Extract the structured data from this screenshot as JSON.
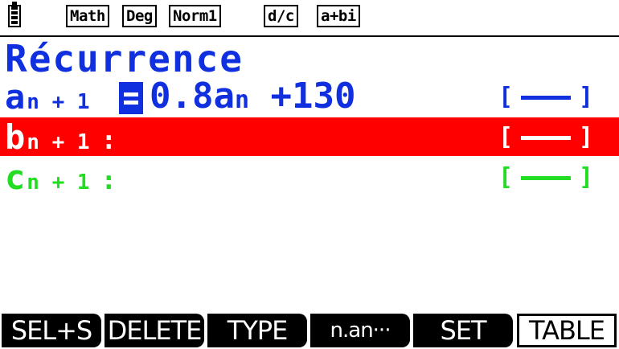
{
  "status": {
    "battery_icon": "battery-full-icon",
    "math_mode": "Math",
    "angle_mode": "Deg",
    "display_mode": "Norm1",
    "fraction_mode": "d/c",
    "complex_mode": "a+bi"
  },
  "title": "Récurrence",
  "colors": {
    "blue": "#1030e0",
    "red": "#ff0000",
    "green": "#22dd22"
  },
  "rows": [
    {
      "var": "a",
      "sub": "n + 1",
      "expr_text": "0.8a",
      "expr_sub": "n",
      "expr_tail": " +130",
      "color": "blue",
      "selected": false
    },
    {
      "var": "b",
      "sub": "n + 1",
      "colon": ":",
      "color": "red",
      "selected": true
    },
    {
      "var": "c",
      "sub": "n + 1",
      "colon": ":",
      "color": "green",
      "selected": false
    }
  ],
  "fkeys": [
    "SEL+S",
    "DELETE",
    "TYPE",
    "n.an···",
    "SET",
    "TABLE"
  ]
}
